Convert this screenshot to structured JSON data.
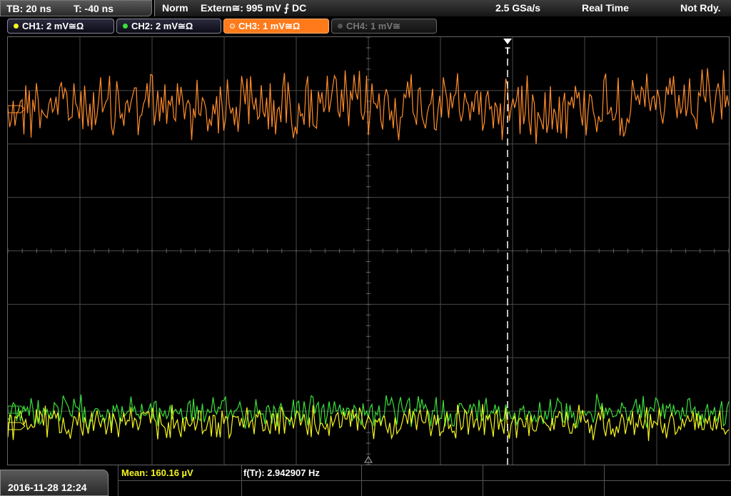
{
  "timebase": {
    "tb": "TB: 20 ns",
    "trigger_time": "T: -40 ns"
  },
  "status": {
    "mode": "Norm",
    "trigger": "Extern≅: 995 mV ⨍ DC",
    "sample_rate": "2.5 GSa/s",
    "acq_mode": "Real Time",
    "state": "Not Rdy."
  },
  "channels": [
    {
      "label": "CH1: 2 mV≅Ω",
      "color": "#f5f51e",
      "active": false,
      "enabled": true
    },
    {
      "label": "CH2: 2 mV≅Ω",
      "color": "#3ae03a",
      "active": false,
      "enabled": true
    },
    {
      "label": "CH3: 1 mV≅Ω",
      "color": "#ff8c2a",
      "active": true,
      "enabled": true
    },
    {
      "label": "CH4: 1 mV≅",
      "color": "#777777",
      "active": false,
      "enabled": false
    }
  ],
  "trigger_marker": "T",
  "footer": {
    "datetime": "2016-11-28 12:24",
    "mean": "Mean: 160.16 µV",
    "frequency": "f(Tr): 2.942907 Hz"
  },
  "colors": {
    "ch1": "#f5f51e",
    "ch2": "#3ae03a",
    "ch3": "#ff8c2a",
    "grid": "#4a4a4a"
  }
}
